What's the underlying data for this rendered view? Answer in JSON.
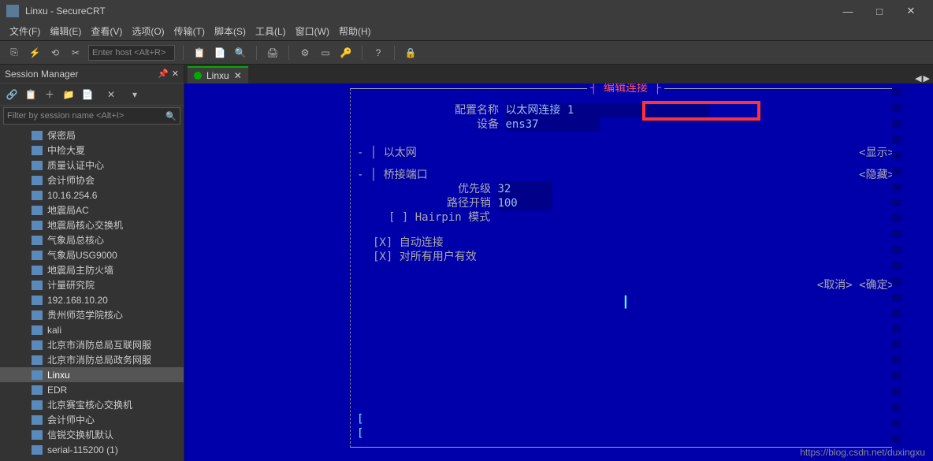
{
  "window": {
    "title": "Linxu - SecureCRT",
    "min": "—",
    "max": "□",
    "close": "✕"
  },
  "menu": {
    "file": "文件(F)",
    "edit": "编辑(E)",
    "view": "查看(V)",
    "options": "选项(O)",
    "transfer": "传输(T)",
    "script": "脚本(S)",
    "tools": "工具(L)",
    "window": "窗口(W)",
    "help": "帮助(H)"
  },
  "toolbar": {
    "host_placeholder": "Enter host <Alt+R>"
  },
  "sidebar": {
    "title": "Session Manager",
    "filter_placeholder": "Filter by session name <Alt+I>",
    "items": [
      {
        "label": "保密局"
      },
      {
        "label": "中检大夏"
      },
      {
        "label": "质量认证中心"
      },
      {
        "label": "会计师协会"
      },
      {
        "label": "10.16.254.6"
      },
      {
        "label": "地震局AC"
      },
      {
        "label": "地震局核心交换机"
      },
      {
        "label": "气象局总核心"
      },
      {
        "label": "气象局USG9000"
      },
      {
        "label": "地震局主防火墙"
      },
      {
        "label": "计量研究院"
      },
      {
        "label": "192.168.10.20"
      },
      {
        "label": "贵州师范学院核心"
      },
      {
        "label": "kali"
      },
      {
        "label": "北京市消防总局互联网服"
      },
      {
        "label": "北京市消防总局政务网服"
      },
      {
        "label": "Linxu",
        "selected": true
      },
      {
        "label": "EDR"
      },
      {
        "label": "北京赛宝核心交换机"
      },
      {
        "label": "会计师中心"
      },
      {
        "label": "信锐交换机默认"
      },
      {
        "label": "serial-115200 (1)"
      }
    ]
  },
  "tab": {
    "label": "Linxu"
  },
  "terminal": {
    "dialog_title": "编辑连接",
    "profile_name_label": "配置名称",
    "profile_name_value": "以太网连接 1",
    "device_label": "设备",
    "device_value": "ens37",
    "ethernet": "以太网",
    "show": "<显示>",
    "bridge_port": "桥接端口",
    "hide": "<隐藏>",
    "priority_label": "优先级",
    "priority_value": "32",
    "pathcost_label": "路径开销",
    "pathcost_value": "100",
    "hairpin": "[ ] Hairpin 模式",
    "auto_connect": "[X] 自动连接",
    "all_users": "[X] 对所有用户有效",
    "cancel": "<取消>",
    "ok": "<确定>",
    "bracket_open": "[",
    "bracket_close": "[",
    "bar": "┃"
  },
  "watermark": "https://blog.csdn.net/duxingxu"
}
